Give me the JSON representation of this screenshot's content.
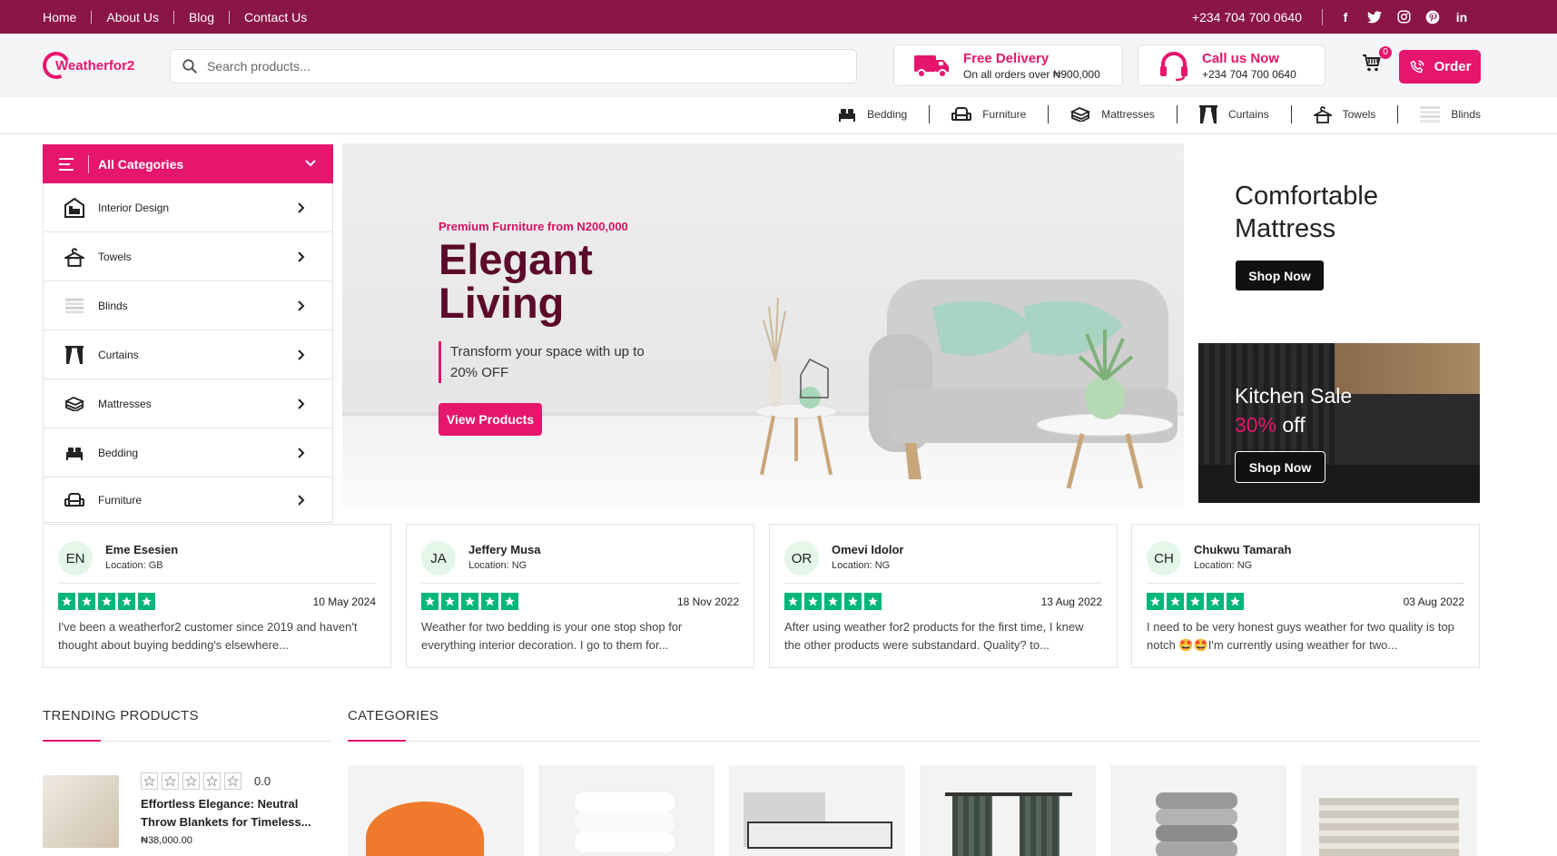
{
  "topbar": {
    "nav": [
      "Home",
      "About Us",
      "Blog",
      "Contact Us"
    ],
    "phone": "+234 704 700 0640",
    "social": [
      "facebook-icon",
      "twitter-icon",
      "instagram-icon",
      "pinterest-icon",
      "linkedin-icon"
    ]
  },
  "header": {
    "logo": "Weatherfor2",
    "search_placeholder": "Search products...",
    "delivery": {
      "title": "Free Delivery",
      "sub": "On all orders over ₦900,000"
    },
    "call": {
      "title": "Call us Now",
      "sub": "+234 704 700 0640"
    },
    "cart_count": "0",
    "order_label": "Order"
  },
  "catstrip": [
    "Bedding",
    "Furniture",
    "Mattresses",
    "Curtains",
    "Towels",
    "Blinds"
  ],
  "sidebar": {
    "title": "All Categories",
    "items": [
      "Interior Design",
      "Towels",
      "Blinds",
      "Curtains",
      "Mattresses",
      "Bedding",
      "Furniture"
    ]
  },
  "hero": {
    "eyebrow": "Premium Furniture from N200,000",
    "title": "Elegant Living",
    "sub": "Transform your space with up to 20% OFF",
    "button": "View Products"
  },
  "promo1": {
    "title": "Comfortable Mattress",
    "button": "Shop Now"
  },
  "promo2": {
    "title": "Kitchen Sale",
    "pct": "30%",
    "off": " off",
    "button": "Shop Now"
  },
  "reviews": [
    {
      "initials": "EN",
      "name": "Eme Esesien",
      "location": "Location: GB",
      "date": "10 May 2024",
      "text": "I've been a weatherfor2 customer since 2019 and haven't thought about buying bedding's elsewhere..."
    },
    {
      "initials": "JA",
      "name": "Jeffery Musa",
      "location": "Location: NG",
      "date": "18 Nov 2022",
      "text": "Weather for two bedding is your one stop shop for everything interior decoration. I go to them for..."
    },
    {
      "initials": "OR",
      "name": "Omevi Idolor",
      "location": "Location: NG",
      "date": "13 Aug 2022",
      "text": "After using weather for2 products for the first time, I knew the other products were substandard. Quality? to..."
    },
    {
      "initials": "CH",
      "name": "Chukwu Tamarah",
      "location": "Location: NG",
      "date": "03 Aug 2022",
      "text": "I need to be very honest guys weather for two quality is top notch 🤩🤩I'm currently using weather for two..."
    }
  ],
  "trending": {
    "heading": "TRENDING PRODUCTS",
    "product": {
      "rating": "0.0",
      "title": "Effortless Elegance: Neutral Throw Blankets for Timeless...",
      "price": "₦38,000.00"
    }
  },
  "categories": {
    "heading": "CATEGORIES"
  },
  "colors": {
    "brand": "#e6156e",
    "topbar": "#8a1547",
    "hero_title": "#5c0a2a",
    "star": "#00b67a"
  }
}
